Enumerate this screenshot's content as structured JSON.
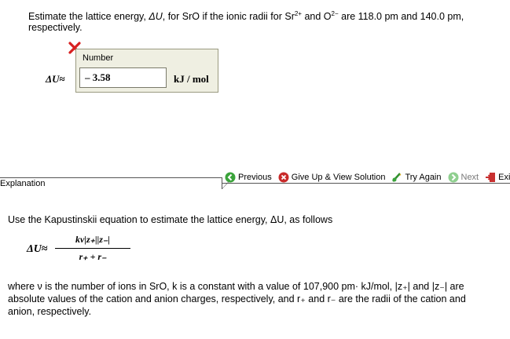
{
  "question": {
    "part1": "Estimate the lattice energy, ",
    "delta_u": "ΔU",
    "part2": ", for SrO if the ionic radii for Sr",
    "sr_charge": "2+",
    "part3": " and O",
    "o_charge": "2−",
    "part4": " are 118.0 pm and 140.0 pm, respectively."
  },
  "answer": {
    "status": "incorrect",
    "field_label": "Number",
    "value": "– 3.58",
    "unit": "kJ / mol",
    "lhs": "ΔU",
    "approx": "≈"
  },
  "explanation_tab": "Explanation",
  "toolbar": {
    "previous": "Previous",
    "give_up": "Give Up & View Solution",
    "try_again": "Try Again",
    "next": "Next",
    "exit": "Exi"
  },
  "explanation": {
    "intro": "Use the Kapustinskii equation to estimate the lattice energy, ΔU, as follows",
    "formula_lhs": "ΔU",
    "formula_approx": "≈",
    "formula_numerator": "kν|z₊||z₋|",
    "formula_denominator": "r₊ + r₋",
    "where_line1": "where ν is the number of ions in SrO, k is a constant with a value of 107,900 pm· kJ/mol, |z₊| and |z₋| are",
    "where_line2": "absolute values of the cation and anion charges, respectively, and r₊ and r₋ are the radii of the cation and",
    "where_line3": "anion, respectively."
  },
  "colors": {
    "box_bg": "#efefe2",
    "error": "#d82020",
    "ok": "#3aa33a",
    "give_up": "#c82a2a"
  },
  "icons": [
    "incorrect-x-icon",
    "previous-arrow-icon",
    "give-up-icon",
    "try-again-icon",
    "next-arrow-icon",
    "exit-icon"
  ]
}
